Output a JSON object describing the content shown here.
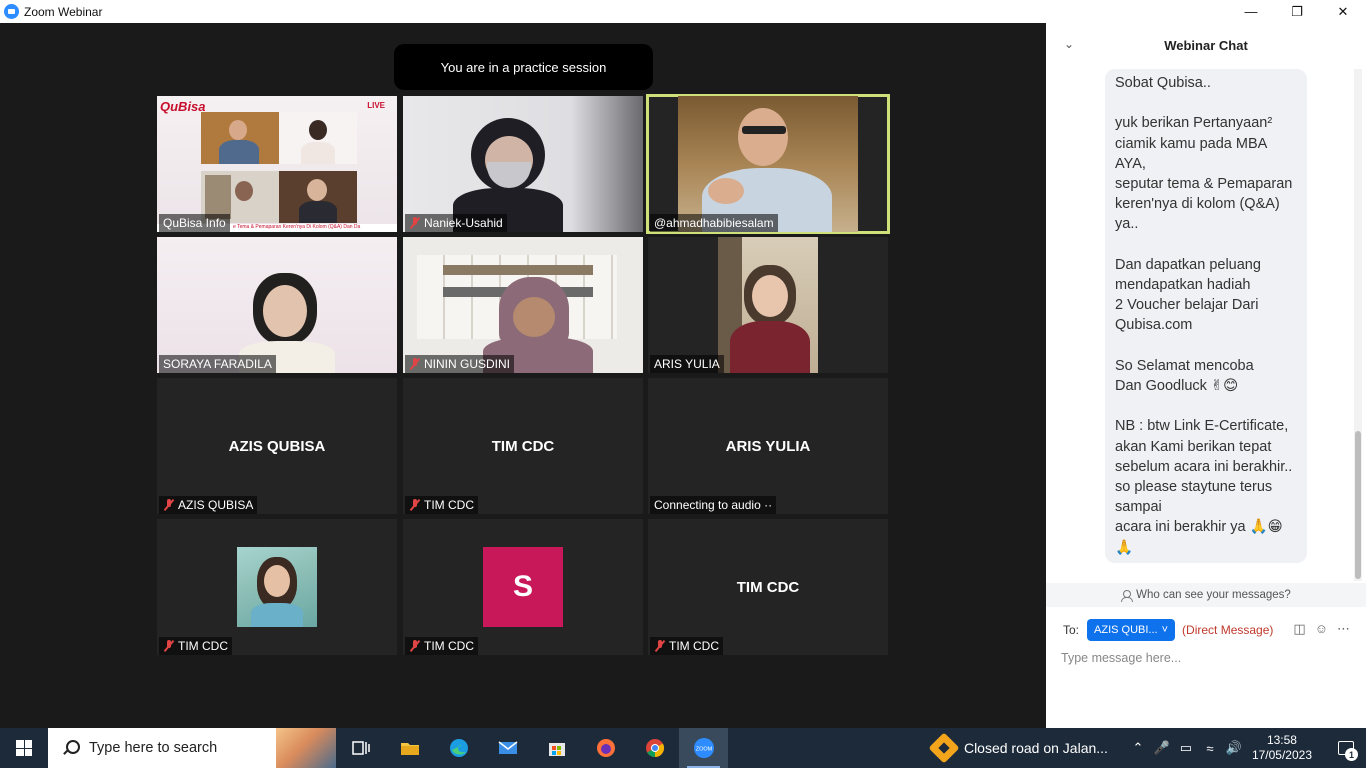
{
  "window": {
    "title": "Zoom Webinar",
    "minimize": "—",
    "maximize": "❐",
    "close": "✕"
  },
  "banner": "You are in a practice session",
  "tiles": [
    {
      "label": "QuBisa Info",
      "muted": false,
      "logo": "QuBisa",
      "live": "LIVE",
      "ticker": "e Tema & Pemaparan Keren'nya Di Kolom (Q&A) Dan Da"
    },
    {
      "label": "Naniek-Usahid",
      "muted": true
    },
    {
      "label": "@ahmadhabibiesalam",
      "muted": false,
      "active": true
    },
    {
      "label": "SORAYA FARADILA",
      "muted": false
    },
    {
      "label": "NININ GUSDINI",
      "muted": true
    },
    {
      "label": "ARIS YULIA",
      "muted": false
    },
    {
      "label": "AZIS QUBISA",
      "muted": true,
      "name_center": "AZIS QUBISA"
    },
    {
      "label": "TIM CDC",
      "muted": true,
      "name_center": "TIM CDC"
    },
    {
      "label": "Connecting to audio ··",
      "muted": false,
      "name_center": "ARIS YULIA"
    },
    {
      "label": "TIM CDC",
      "muted": true
    },
    {
      "label": "TIM CDC",
      "muted": true,
      "avatar_letter": "S"
    },
    {
      "label": "TIM CDC",
      "muted": true,
      "name_center": "TIM CDC"
    }
  ],
  "chat": {
    "title": "Webinar Chat",
    "message": "Sobat Qubisa..\n\nyuk berikan Pertanyaan²\nciamik kamu pada MBA\nAYA,\nseputar tema & Pemaparan\nkeren'nya di kolom (Q&A)\nya..\n\nDan dapatkan peluang\nmendapatkan hadiah\n2 Voucher belajar Dari\nQubisa.com\n\nSo Selamat mencoba\nDan Goodluck ✌😊\n\nNB : btw Link E-Certificate,\nakan Kami berikan tepat\nsebelum acara ini berakhir..\nso please staytune terus\nsampai\nacara ini berakhir ya 🙏😁\n🙏",
    "who_can_see": "Who can see your messages?",
    "to_label": "To:",
    "recipient": "AZIS QUBI...",
    "direct": "(Direct Message)",
    "input_placeholder": "Type message here..."
  },
  "taskbar": {
    "search_placeholder": "Type here to search",
    "news": "Closed road on Jalan...",
    "time": "13:58",
    "date": "17/05/2023",
    "notifications": "1",
    "zoom_label": "ZOOM"
  }
}
